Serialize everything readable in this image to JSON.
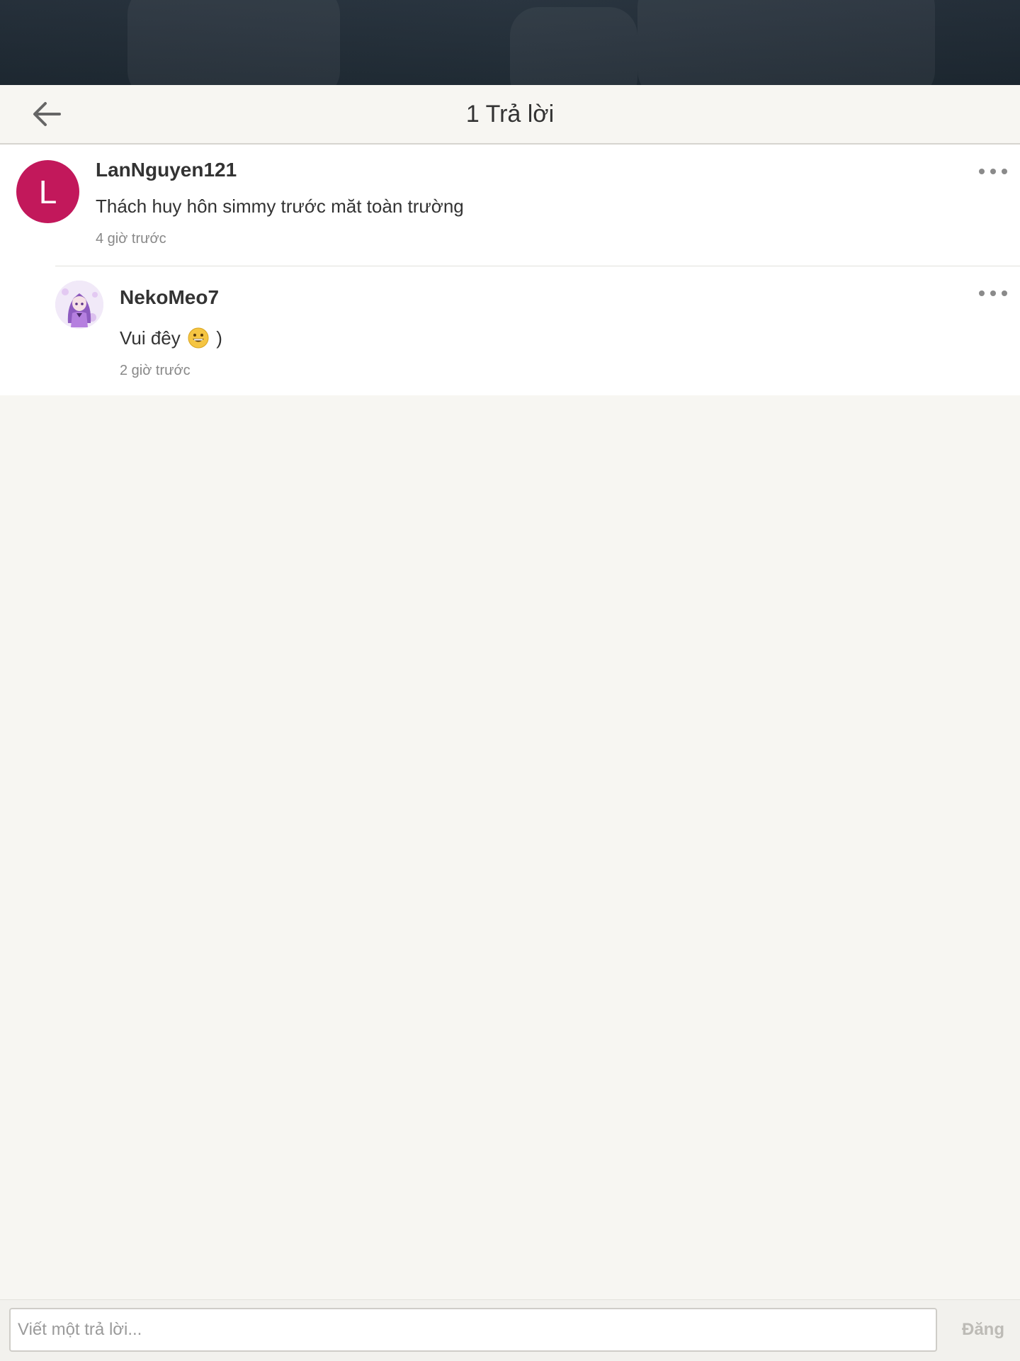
{
  "header": {
    "title": "1 Trả lời",
    "back_icon": "arrow-left-icon"
  },
  "parent_comment": {
    "avatar_letter": "L",
    "avatar_color": "#c2185b",
    "username": "LanNguyen121",
    "text": "Thách huy hôn simmy trước măt toàn trường",
    "time": "4 giờ trước",
    "more_icon": "more-horizontal-icon"
  },
  "reply_comment": {
    "avatar_icon": "anime-avatar-image",
    "username": "NekoMeo7",
    "text_before_emoji": "Vui đêy",
    "emoji": "grinning-face-emoji",
    "text_after_emoji": ")",
    "time": "2 giờ trước",
    "more_icon": "more-horizontal-icon"
  },
  "composer": {
    "placeholder": "Viết một trả lời...",
    "post_label": "Đăng"
  },
  "colors": {
    "background": "#f7f6f2",
    "accent_avatar": "#c2185b",
    "post_disabled": "#bdbbb6"
  }
}
